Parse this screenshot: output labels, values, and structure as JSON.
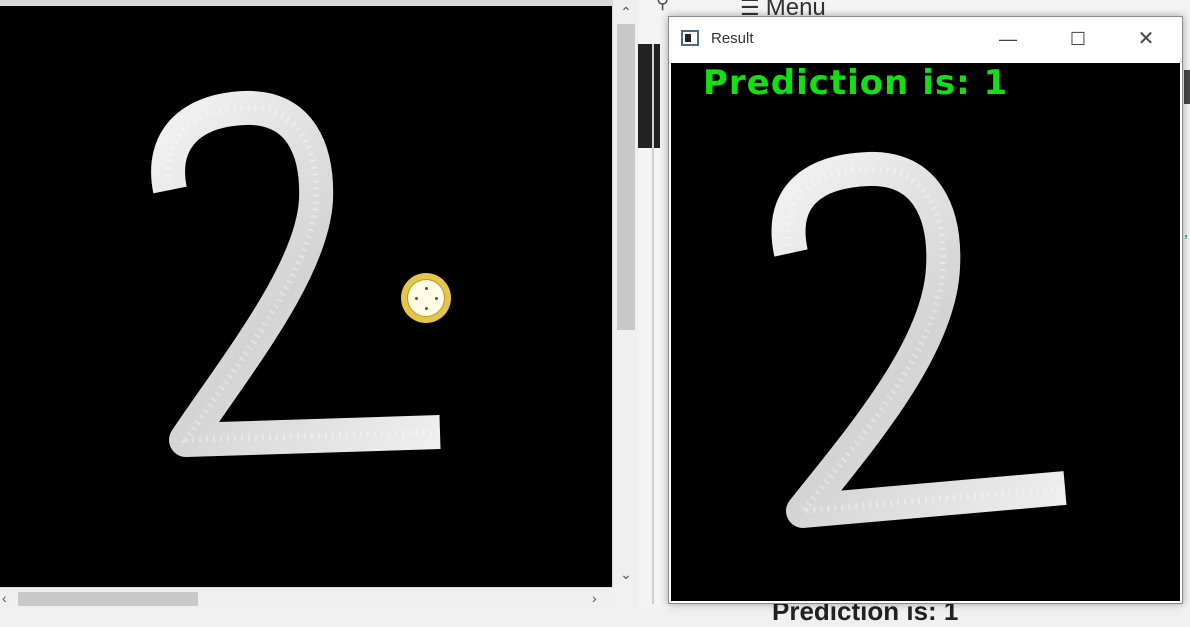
{
  "background_app": {
    "menu_label": "Menu",
    "bottom_partial_text": "Prediction is: 1"
  },
  "result_window": {
    "title": "Result",
    "prediction_text": "Prediction is: 1",
    "prediction_color": "#12e012"
  },
  "drawn_digit": "2",
  "icons": {
    "minimize": "minimize-icon",
    "maximize": "maximize-icon",
    "close": "close-icon",
    "app": "window-app-icon",
    "cursor": "cursor-crosshair-icon"
  }
}
